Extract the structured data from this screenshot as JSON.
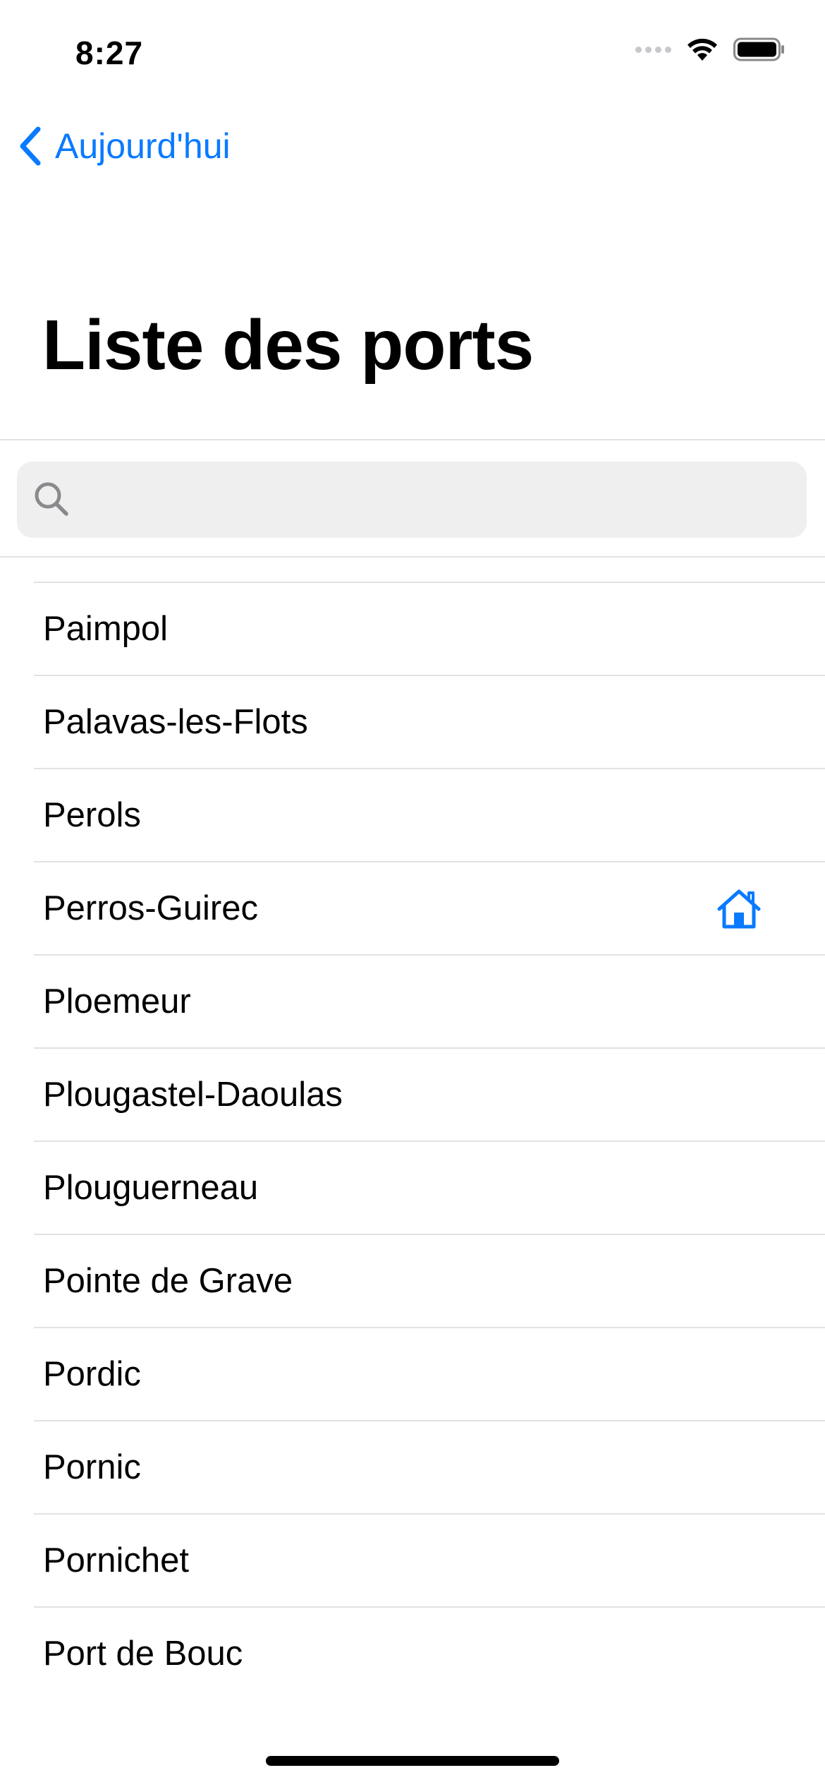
{
  "status_bar": {
    "time": "8:27"
  },
  "nav": {
    "back_label": "Aujourd'hui",
    "title": "Liste des ports"
  },
  "search": {
    "value": "",
    "placeholder": ""
  },
  "ports": [
    {
      "name": "Paimpol",
      "home": false
    },
    {
      "name": "Palavas-les-Flots",
      "home": false
    },
    {
      "name": "Perols",
      "home": false
    },
    {
      "name": "Perros-Guirec",
      "home": true
    },
    {
      "name": "Ploemeur",
      "home": false
    },
    {
      "name": "Plougastel-Daoulas",
      "home": false
    },
    {
      "name": "Plouguerneau",
      "home": false
    },
    {
      "name": "Pointe de Grave",
      "home": false
    },
    {
      "name": "Pordic",
      "home": false
    },
    {
      "name": "Pornic",
      "home": false
    },
    {
      "name": "Pornichet",
      "home": false
    },
    {
      "name": "Port de Bouc",
      "home": false
    }
  ],
  "colors": {
    "accent": "#0a7aff",
    "separator": "#e2e2e6",
    "search_bg": "#efeff0"
  },
  "icons": {
    "back": "chevron-left-icon",
    "search": "magnifier-icon",
    "home": "house-icon"
  }
}
